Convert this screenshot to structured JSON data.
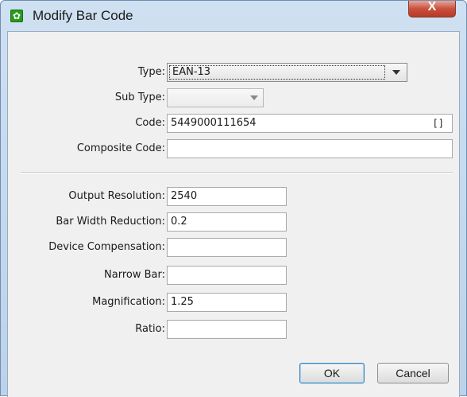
{
  "window": {
    "title": "Modify Bar Code",
    "close_glyph": "X",
    "app_icon": "gear-icon"
  },
  "form": {
    "type": {
      "label": "Type:",
      "value": "EAN-13"
    },
    "sub_type": {
      "label": "Sub Type:",
      "value": ""
    },
    "code": {
      "label": "Code:",
      "value": "5449000111654",
      "icon_glyph": "[]"
    },
    "composite_code": {
      "label": "Composite Code:",
      "value": ""
    },
    "output_resolution": {
      "label": "Output Resolution:",
      "value": "2540"
    },
    "bar_width_reduction": {
      "label": "Bar Width Reduction:",
      "value": "0.2"
    },
    "device_compensation": {
      "label": "Device Compensation:",
      "value": ""
    },
    "narrow_bar": {
      "label": "Narrow Bar:",
      "value": ""
    },
    "magnification": {
      "label": "Magnification:",
      "value": "1.25"
    },
    "ratio": {
      "label": "Ratio:",
      "value": ""
    }
  },
  "buttons": {
    "ok": "OK",
    "cancel": "Cancel"
  }
}
